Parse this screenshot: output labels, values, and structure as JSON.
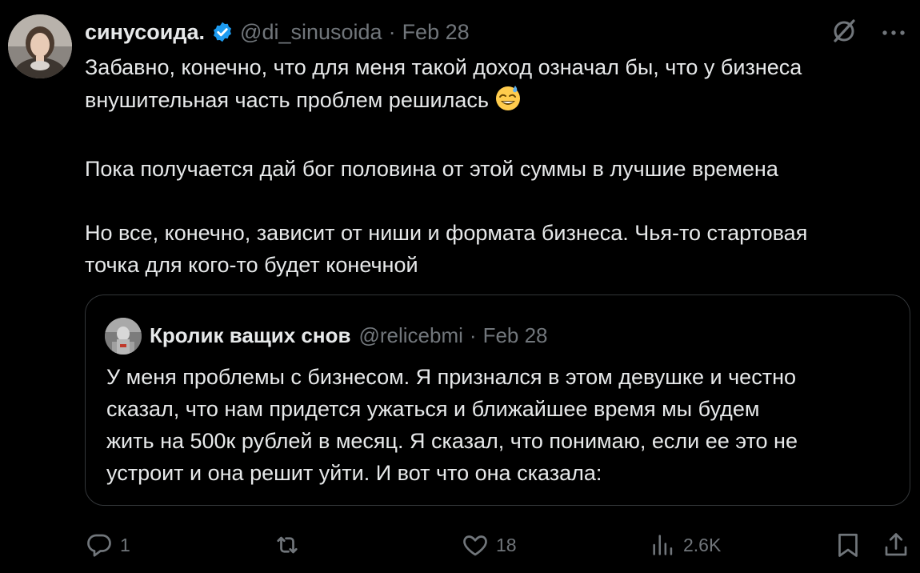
{
  "post": {
    "author_name": "синусоида.",
    "author_handle": "@di_sinusoida",
    "separator": "·",
    "date": "Feb 28",
    "text_lines": [
      [
        "Забавно, конечно, что для меня такой доход означал бы, что у бизнеса",
        "внушительная часть проблем решилась"
      ],
      [
        "Пока получается дай бог половина от этой суммы в лучшие времена"
      ],
      [
        "Но все, конечно, зависит от ниши и формата бизнеса. Чья-то стартовая",
        "точка для кого-то будет конечной"
      ]
    ],
    "emoji": "grinning-sweat-emoji"
  },
  "quoted_post": {
    "author_name": "Кролик ващих снов",
    "author_handle": "@relicebmi",
    "separator": "·",
    "date": "Feb 28",
    "text_lines": [
      "У меня проблемы с бизнесом. Я признался в этом девушке и честно",
      "сказал, что нам придется ужаться и ближайшее время мы будем",
      "жить на 500к рублей в месяц. Я сказал, что понимаю, если ее это не",
      "устроит и она решит уйти. И вот что она сказала:"
    ]
  },
  "actions": {
    "replies": "1",
    "reposts": "",
    "likes": "18",
    "views": "2.6K"
  },
  "icons": {
    "verified": "verified-badge-icon",
    "grok": "grok-icon",
    "more": "more-icon",
    "reply": "reply-icon",
    "repost": "repost-icon",
    "like": "like-icon",
    "views": "views-icon",
    "bookmark": "bookmark-icon",
    "share": "share-icon"
  },
  "colors": {
    "background": "#000000",
    "text": "#e7e9ea",
    "muted": "#71767b",
    "verified": "#1d9bf0",
    "border": "#333639"
  }
}
